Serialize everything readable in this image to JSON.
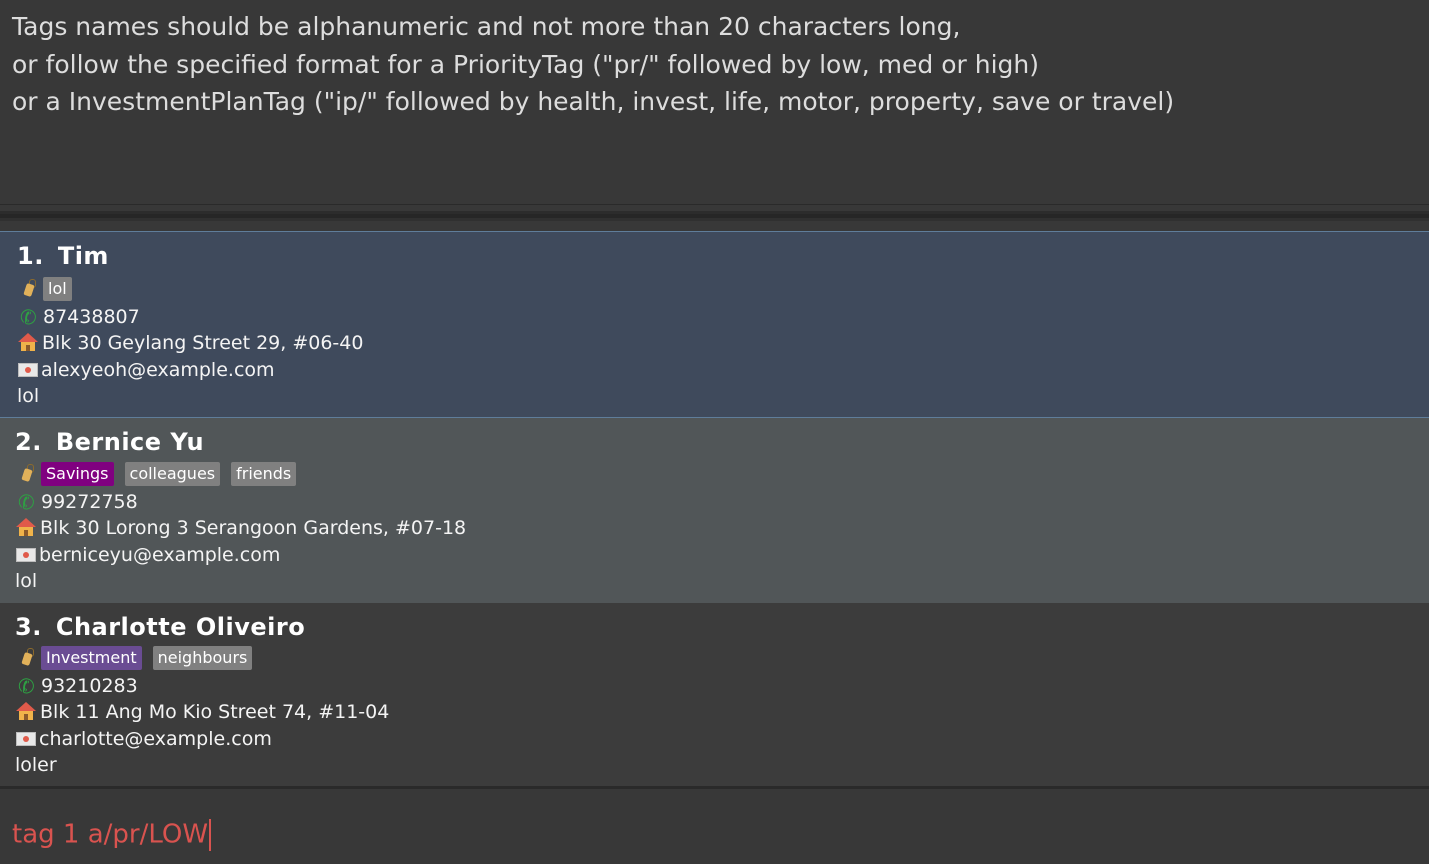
{
  "result_display": {
    "lines": [
      "Tags names should be alphanumeric and not more than 20 characters long,",
      "or follow the specified format for a PriorityTag (\"pr/\" followed by low, med or high)",
      "or a InvestmentPlanTag (\"ip/\" followed by health, invest, life, motor, property, save or travel)"
    ]
  },
  "persons": [
    {
      "index": "1.",
      "name": "Tim",
      "tags": [
        {
          "label": "lol",
          "color": "#808080"
        }
      ],
      "phone": "87438807",
      "address": "Blk 30 Geylang Street 29, #06-40",
      "email": "alexyeoh@example.com",
      "remark": "lol"
    },
    {
      "index": "2.",
      "name": "Bernice Yu",
      "tags": [
        {
          "label": "Savings",
          "color": "#800080"
        },
        {
          "label": "colleagues",
          "color": "#808080"
        },
        {
          "label": "friends",
          "color": "#808080"
        }
      ],
      "phone": "99272758",
      "address": "Blk 30 Lorong 3 Serangoon Gardens, #07-18",
      "email": "berniceyu@example.com",
      "remark": "lol"
    },
    {
      "index": "3.",
      "name": "Charlotte Oliveiro",
      "tags": [
        {
          "label": "Investment",
          "color": "#6a4c93"
        },
        {
          "label": "neighbours",
          "color": "#808080"
        }
      ],
      "phone": "93210283",
      "address": "Blk 11 Ang Mo Kio Street 74, #11-04",
      "email": "charlotte@example.com",
      "remark": "loler"
    }
  ],
  "icons": {
    "tag": "tag-icon",
    "phone": "phone-icon",
    "address": "house-icon",
    "email": "envelope-icon"
  },
  "command_box": {
    "value": "tag 1 a/pr/LOW",
    "text_color": "#d9534f"
  },
  "colors": {
    "selected_card": "#3f4a5c",
    "alt_card": "#515658",
    "background": "#3c3c3c"
  }
}
